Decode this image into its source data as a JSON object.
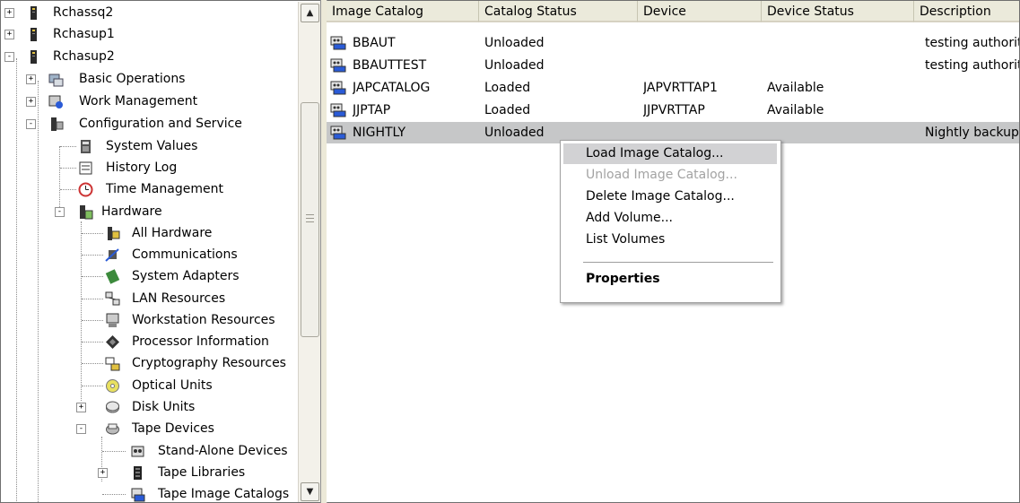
{
  "tree": {
    "nodes": [
      {
        "label": "Rchassq2",
        "icon": "server-icon",
        "expander": "+"
      },
      {
        "label": "Rchasup1",
        "icon": "server-icon",
        "expander": "+"
      },
      {
        "label": "Rchasup2",
        "icon": "server-icon",
        "expander": "-"
      },
      {
        "label": "Basic Operations",
        "icon": "basic-operations-icon",
        "expander": "+"
      },
      {
        "label": "Work Management",
        "icon": "work-management-icon",
        "expander": "+"
      },
      {
        "label": "Configuration and Service",
        "icon": "configuration-icon",
        "expander": "-"
      },
      {
        "label": "System Values",
        "icon": "system-values-icon"
      },
      {
        "label": "History Log",
        "icon": "history-log-icon"
      },
      {
        "label": "Time Management",
        "icon": "clock-icon"
      },
      {
        "label": "Hardware",
        "icon": "hardware-icon",
        "expander": "-"
      },
      {
        "label": "All Hardware",
        "icon": "all-hardware-icon"
      },
      {
        "label": "Communications",
        "icon": "communications-icon"
      },
      {
        "label": "System Adapters",
        "icon": "system-adapters-icon"
      },
      {
        "label": "LAN Resources",
        "icon": "lan-resources-icon"
      },
      {
        "label": "Workstation Resources",
        "icon": "workstation-resources-icon"
      },
      {
        "label": "Processor Information",
        "icon": "processor-icon"
      },
      {
        "label": "Cryptography Resources",
        "icon": "cryptography-icon"
      },
      {
        "label": "Optical Units",
        "icon": "optical-disc-icon"
      },
      {
        "label": "Disk Units",
        "icon": "disk-units-icon",
        "expander": "+"
      },
      {
        "label": "Tape Devices",
        "icon": "tape-devices-icon",
        "expander": "-"
      },
      {
        "label": "Stand-Alone Devices",
        "icon": "tape-drive-icon"
      },
      {
        "label": "Tape Libraries",
        "icon": "tape-library-icon",
        "expander": "+"
      },
      {
        "label": "Tape Image Catalogs",
        "icon": "image-catalog-icon"
      }
    ]
  },
  "list": {
    "columns": [
      "Image Catalog",
      "Catalog Status",
      "Device",
      "Device Status",
      "Description"
    ],
    "rows": [
      {
        "catalog": "BBAUT",
        "status": "Unloaded",
        "device": "",
        "device_status": "",
        "description": "testing authority"
      },
      {
        "catalog": "BBAUTTEST",
        "status": "Unloaded",
        "device": "",
        "device_status": "",
        "description": "testing authority"
      },
      {
        "catalog": "JAPCATALOG",
        "status": "Loaded",
        "device": "JAPVRTTAP1",
        "device_status": "Available",
        "description": ""
      },
      {
        "catalog": "JJPTAP",
        "status": "Loaded",
        "device": "JJPVRTTAP",
        "device_status": "Available",
        "description": ""
      },
      {
        "catalog": "NIGHTLY",
        "status": "Unloaded",
        "device": "",
        "device_status": "",
        "description": "Nightly backup"
      }
    ]
  },
  "context_menu": {
    "items": [
      {
        "label": "Load Image Catalog...",
        "state": "highlighted"
      },
      {
        "label": "Unload Image Catalog...",
        "state": "disabled"
      },
      {
        "label": "Delete Image Catalog...",
        "state": "normal"
      },
      {
        "label": "Add Volume...",
        "state": "normal"
      },
      {
        "label": "List Volumes",
        "state": "normal"
      },
      {
        "label": "Properties",
        "state": "bold"
      }
    ]
  },
  "colors": {
    "selection": "#c6c7c8",
    "menu_highlight": "#d2d2d4",
    "header_bg": "#ebeadb",
    "disabled_text": "#a3a3a3"
  }
}
